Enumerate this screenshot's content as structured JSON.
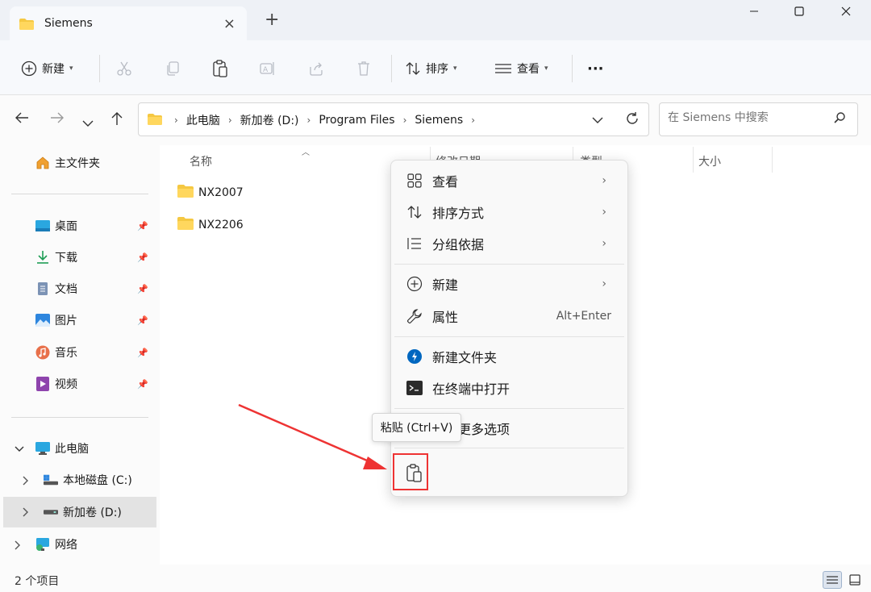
{
  "window": {
    "tab_title": "Siemens",
    "minimize": "—",
    "maximize": "☐",
    "close": "✕"
  },
  "toolbar": {
    "new_label": "新建",
    "sort_label": "排序",
    "view_label": "查看",
    "more": "···"
  },
  "address": {
    "crumbs": [
      "此电脑",
      "新加卷 (D:)",
      "Program Files",
      "Siemens"
    ],
    "search_placeholder": "在 Siemens 中搜索"
  },
  "sidebar": {
    "home": "主文件夹",
    "quick": [
      {
        "label": "桌面"
      },
      {
        "label": "下载"
      },
      {
        "label": "文档"
      },
      {
        "label": "图片"
      },
      {
        "label": "音乐"
      },
      {
        "label": "视频"
      }
    ],
    "this_pc": "此电脑",
    "drive_c": "本地磁盘 (C:)",
    "drive_d": "新加卷 (D:)",
    "network": "网络"
  },
  "columns": {
    "name": "名称",
    "modified": "修改日期",
    "type": "类型",
    "size": "大小"
  },
  "files": [
    {
      "name": "NX2007"
    },
    {
      "name": "NX2206"
    }
  ],
  "context_menu": {
    "view": "查看",
    "sort": "排序方式",
    "group": "分组依据",
    "new": "新建",
    "properties": "属性",
    "properties_shortcut": "Alt+Enter",
    "new_folder": "新建文件夹",
    "open_terminal": "在终端中打开",
    "more_options": "显示更多选项",
    "paste_tooltip": "粘贴 (Ctrl+V)"
  },
  "status": {
    "count": "2 个项目"
  },
  "colors": {
    "folder": "#f5c842",
    "highlight_red": "#e33",
    "accent_blue": "#0067c0"
  }
}
